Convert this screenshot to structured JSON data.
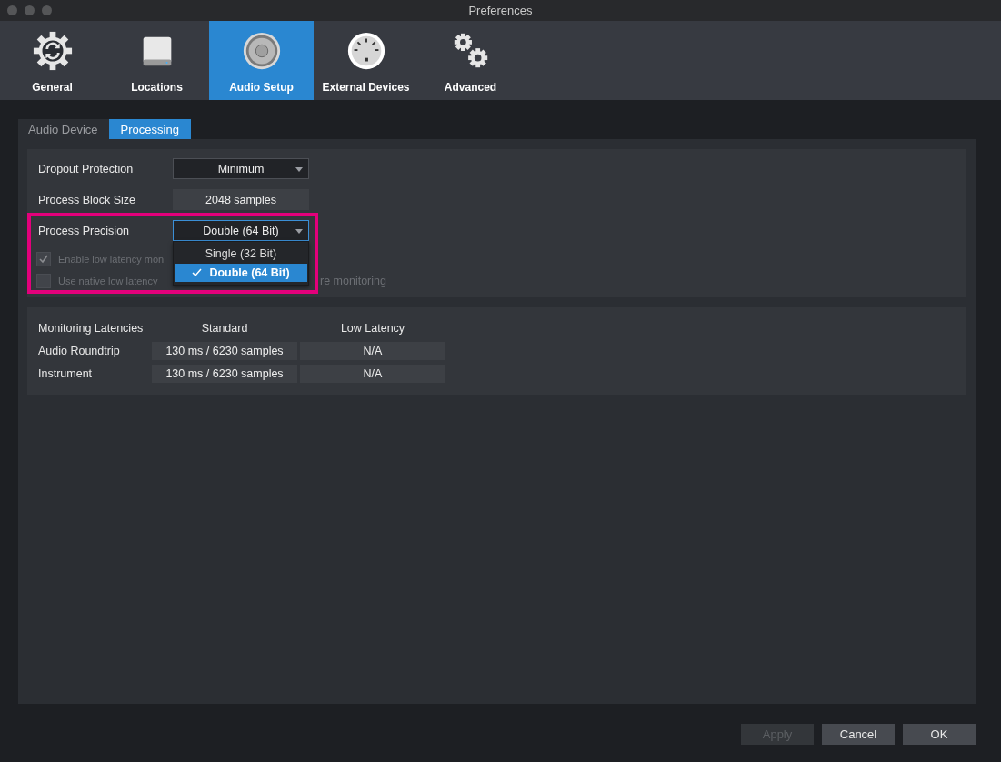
{
  "window": {
    "title": "Preferences"
  },
  "toolbar": [
    {
      "label": "General",
      "selected": false
    },
    {
      "label": "Locations",
      "selected": false
    },
    {
      "label": "Audio Setup",
      "selected": true
    },
    {
      "label": "External Devices",
      "selected": false
    },
    {
      "label": "Advanced",
      "selected": false
    }
  ],
  "tabs": [
    {
      "label": "Audio Device",
      "selected": false
    },
    {
      "label": "Processing",
      "selected": true
    }
  ],
  "settings": [
    {
      "label": "Dropout Protection",
      "kind": "dropdown",
      "value": "Minimum",
      "focused": false
    },
    {
      "label": "Process Block Size",
      "kind": "readout",
      "value": "2048 samples"
    },
    {
      "label": "Process Precision",
      "kind": "dropdown",
      "value": "Double (64 Bit)",
      "focused": true
    }
  ],
  "dropdown_menu": [
    {
      "label": "Single (32 Bit)",
      "selected": false
    },
    {
      "label": "Double (64 Bit)",
      "selected": true
    }
  ],
  "checkboxes": [
    {
      "label": "Enable low latency mon",
      "checked": true,
      "disabled": true
    },
    {
      "label": "Use native low latency",
      "label_tail": "re monitoring",
      "checked": false,
      "disabled": true
    }
  ],
  "highlight_frame": true,
  "latencies": {
    "columns": [
      "Monitoring Latencies",
      "Standard",
      "Low Latency"
    ],
    "rows": [
      {
        "name": "Audio Roundtrip",
        "standard": "130 ms / 6230 samples",
        "low_latency": "N/A"
      },
      {
        "name": "Instrument",
        "standard": "130 ms / 6230 samples",
        "low_latency": "N/A"
      }
    ]
  },
  "buttons": [
    {
      "label": "Apply",
      "disabled": true
    },
    {
      "label": "Cancel",
      "disabled": false
    },
    {
      "label": "OK",
      "disabled": false
    }
  ]
}
